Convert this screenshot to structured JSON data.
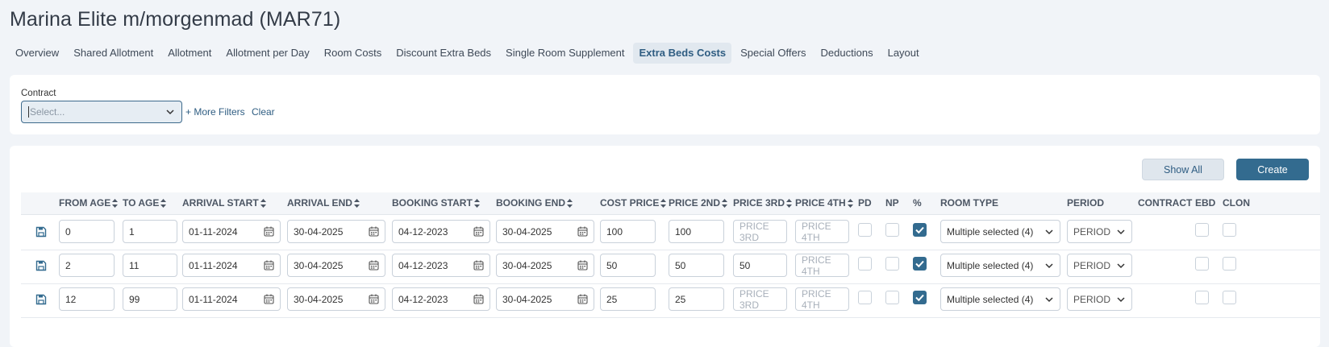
{
  "page": {
    "title": "Marina Elite m/morgenmad (MAR71)"
  },
  "tabs": [
    {
      "label": "Overview"
    },
    {
      "label": "Shared Allotment"
    },
    {
      "label": "Allotment"
    },
    {
      "label": "Allotment per Day"
    },
    {
      "label": "Room Costs"
    },
    {
      "label": "Discount Extra Beds"
    },
    {
      "label": "Single Room Supplement"
    },
    {
      "label": "Extra Beds Costs",
      "active": true
    },
    {
      "label": "Special Offers"
    },
    {
      "label": "Deductions"
    },
    {
      "label": "Layout"
    }
  ],
  "filters": {
    "contract_label": "Contract",
    "contract_placeholder": "Select...",
    "more_filters": "+ More Filters",
    "clear": "Clear"
  },
  "actions": {
    "show_all": "Show All",
    "create": "Create"
  },
  "columns": {
    "from_age": "FROM AGE",
    "to_age": "TO AGE",
    "arrival_start": "ARRIVAL START",
    "arrival_end": "ARRIVAL END",
    "booking_start": "BOOKING START",
    "booking_end": "BOOKING END",
    "cost_price": "COST PRICE",
    "price_2nd": "PRICE 2ND",
    "price_3rd": "PRICE 3RD",
    "price_4th": "PRICE 4TH",
    "pd": "PD",
    "np": "NP",
    "pct": "%",
    "room_type": "ROOM TYPE",
    "period": "PERIOD",
    "contract": "CONTRACT",
    "ebd": "EBD",
    "clone": "CLON"
  },
  "placeholders": {
    "price_3rd": "PRICE 3RD",
    "price_4th": "PRICE 4TH"
  },
  "rows": [
    {
      "from_age": "0",
      "to_age": "1",
      "arrival_start": "01-11-2024",
      "arrival_end": "30-04-2025",
      "booking_start": "04-12-2023",
      "booking_end": "30-04-2025",
      "cost_price": "100",
      "price_2nd": "100",
      "price_3rd": "",
      "price_4th": "",
      "pd": false,
      "np": false,
      "pct": true,
      "room_type": "Multiple selected (4)",
      "period": "PERIOD",
      "ebd": false,
      "clone": false
    },
    {
      "from_age": "2",
      "to_age": "11",
      "arrival_start": "01-11-2024",
      "arrival_end": "30-04-2025",
      "booking_start": "04-12-2023",
      "booking_end": "30-04-2025",
      "cost_price": "50",
      "price_2nd": "50",
      "price_3rd": "50",
      "price_4th": "",
      "pd": false,
      "np": false,
      "pct": true,
      "room_type": "Multiple selected (4)",
      "period": "PERIOD",
      "ebd": false,
      "clone": false
    },
    {
      "from_age": "12",
      "to_age": "99",
      "arrival_start": "01-11-2024",
      "arrival_end": "30-04-2025",
      "booking_start": "04-12-2023",
      "booking_end": "30-04-2025",
      "cost_price": "25",
      "price_2nd": "25",
      "price_3rd": "",
      "price_4th": "",
      "pd": false,
      "np": false,
      "pct": true,
      "room_type": "Multiple selected (4)",
      "period": "PERIOD",
      "ebd": false,
      "clone": false
    }
  ],
  "colors": {
    "accent": "#336b8f",
    "tab_active_bg": "#e1e8ef",
    "page_bg": "#f1f4f8"
  }
}
